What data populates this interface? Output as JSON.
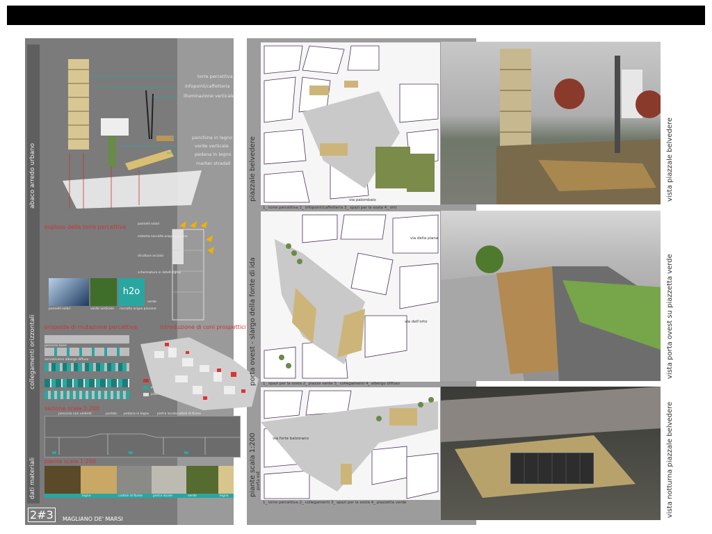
{
  "labels": {
    "torre_percettiva": "torre percettiva",
    "infopoint": "infopoint/caffetteria",
    "illuminazione": "illuminazione verticale",
    "panchine": "panchine in legno",
    "verde": "verde verticale",
    "pedana": "pedana in legno",
    "marker": "marker stradali"
  },
  "left": {
    "abaco": "abaco arredo urbano",
    "esploso": "esploso della torre percettiva",
    "collegamenti": "collegamenti orizzontali",
    "proposta": "proposta di mutazione percettiva",
    "introduzione": "introduzione di coni prospettici",
    "pianta": "pianta scala 1:200",
    "dati": "dati materiali",
    "sezione": "sezione scala 1:200",
    "percorso_base": "percorso base",
    "servizi": "servizi/cenni albergo diffuso",
    "legend": [
      "albergo diffuso",
      "pavimentazione/cenni",
      "pavimentazione"
    ],
    "materials": [
      "legno",
      "ciottoli di fiume",
      "pietra locale",
      "verde",
      "legno"
    ],
    "tower_ann": [
      "pannelli solari",
      "sistema raccolta acque piovane",
      "struttura acciaio",
      "schermature in listelli lignei",
      "verde"
    ],
    "energy": [
      "pannelli solari",
      "verde verticale",
      "raccolta acque piovane"
    ],
    "h2o": "h2o",
    "section_ann": [
      "percorso non vedenti",
      "portale",
      "pedana in legno",
      "pietra locale",
      "ciottoli di fiume"
    ],
    "board_id": "2#3",
    "town": "MAGLIANO DE' MARSI"
  },
  "middle": {
    "belvedere": "piazzale belvedere",
    "porta_ovest": "porta ovest - slargo della fonte di ida",
    "piante": "piante scala 1:200",
    "porta_est": "porta est",
    "cap1": "1_ torre percettiva    2_ infopoint/caffetteria    3_ spazi per la sosta    4_ orti",
    "cap2": "1_ spazi per la sosta    2_ piazza verde    3_ collegamenti    4_ albergo diffuso",
    "cap3": "1_ torre percettiva    2_ collegamenti    3_ spazi per la sosta    4_ piazzetta verde",
    "street1": "via palombaio",
    "street2": "via dell'orto",
    "street3": "via della piana",
    "street4": "via forte balzorano"
  },
  "right": {
    "vista1": "vista piazzale belvedere",
    "vista2": "vista porta ovest su piazzetta verde",
    "vista3": "vista notturna piazzale belvedere"
  },
  "colors": {
    "bg": "#7b7b7b",
    "accent": "#c33",
    "teal": "#2aa6a0",
    "wood": "#cdb57a"
  }
}
